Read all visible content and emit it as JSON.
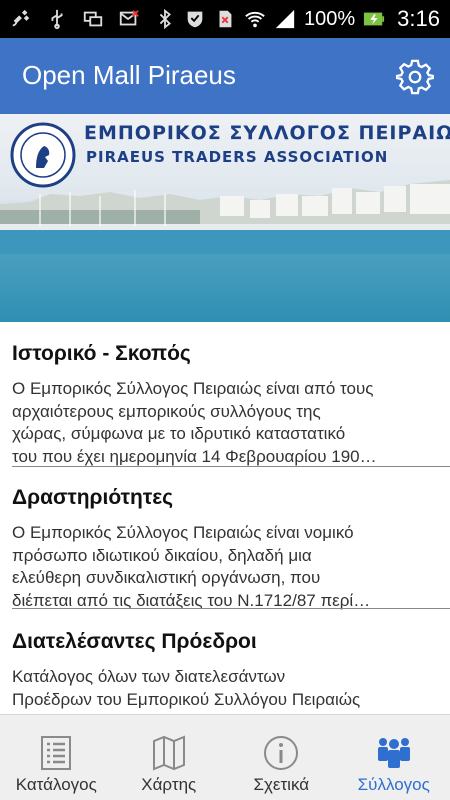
{
  "status_bar": {
    "battery_text": "100%",
    "time": "3:16"
  },
  "app_bar": {
    "title": "Open Mall Piraeus",
    "settings_icon": "gear-icon"
  },
  "banner": {
    "title_greek": "ΕΜΠΟΡΙΚΟΣ ΣΥΛΛΟΓΟΣ ΠΕΙΡΑΙΩΣ",
    "title_english": "PIRAEUS TRADERS ASSOCIATION"
  },
  "sections": [
    {
      "title": "Ιστορικό - Σκοπός",
      "lines": [
        "Ο Εμπορικός Σύλλογος Πειραιώς είναι από τους",
        "αρχαιότερους εμπορικούς συλλόγους της",
        "χώρας, σύμφωνα με το ιδρυτικό καταστατικό",
        "του που έχει ημερομηνία 14 Φεβρουαρίου 190…"
      ]
    },
    {
      "title": "Δραστηριότητες",
      "lines": [
        "Ο Εμπορικός Σύλλογος Πειραιώς είναι νομικό",
        "πρόσωπο ιδιωτικού δικαίου, δηλαδή μια",
        "ελεύθερη συνδικαλιστική οργάνωση, που",
        "διέπεται από τις διατάξεις του Ν.1712/87 περί…"
      ]
    },
    {
      "title": "Διατελέσαντες Πρόεδροι",
      "lines": [
        "Κατάλογος όλων των διατελεσάντων",
        "Προέδρων του Εμπορικού Συλλόγου Πειραιώς"
      ]
    }
  ],
  "bottom_nav": {
    "items": [
      {
        "label": "Κατάλογος",
        "icon": "list-icon"
      },
      {
        "label": "Χάρτης",
        "icon": "map-icon"
      },
      {
        "label": "Σχετικά",
        "icon": "info-icon"
      },
      {
        "label": "Σύλλογος",
        "icon": "people-icon"
      }
    ],
    "active_index": 3,
    "active_color": "#2f6fd0"
  },
  "colors": {
    "app_bar": "#3e73c6",
    "banner_text": "#1d3f86"
  }
}
